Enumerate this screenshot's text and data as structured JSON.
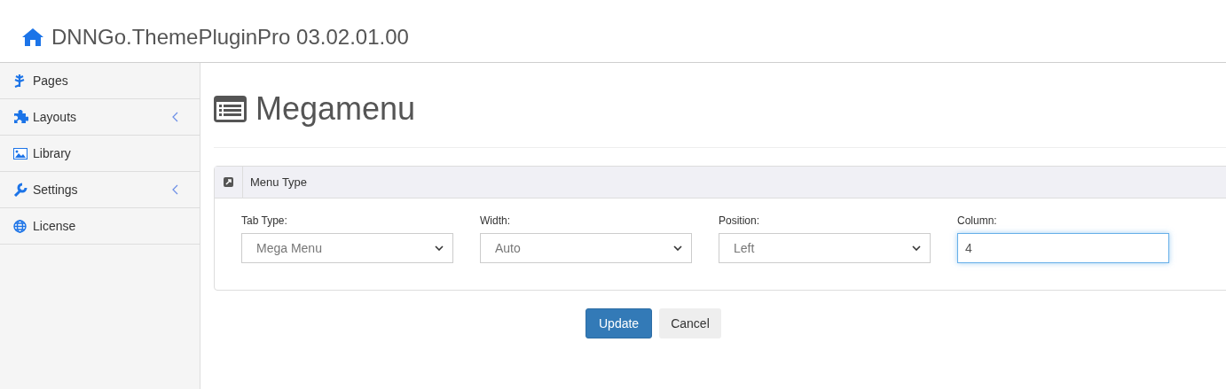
{
  "header": {
    "title": "DNNGo.ThemePluginPro 03.02.01.00"
  },
  "sidebar": {
    "items": [
      {
        "label": "Pages",
        "expandable": false
      },
      {
        "label": "Layouts",
        "expandable": true
      },
      {
        "label": "Library",
        "expandable": false
      },
      {
        "label": "Settings",
        "expandable": true
      },
      {
        "label": "License",
        "expandable": false
      }
    ]
  },
  "page": {
    "title": "Megamenu"
  },
  "panel": {
    "title": "Menu Type",
    "fields": [
      {
        "label": "Tab Type:",
        "kind": "select",
        "value": "Mega Menu",
        "focused": false
      },
      {
        "label": "Width:",
        "kind": "select",
        "value": "Auto",
        "focused": false
      },
      {
        "label": "Position:",
        "kind": "select",
        "value": "Left",
        "focused": false
      },
      {
        "label": "Column:",
        "kind": "text",
        "value": "4",
        "focused": true
      }
    ]
  },
  "buttons": [
    {
      "label": "Update",
      "kind": "primary"
    },
    {
      "label": "Cancel",
      "kind": "default"
    }
  ]
}
